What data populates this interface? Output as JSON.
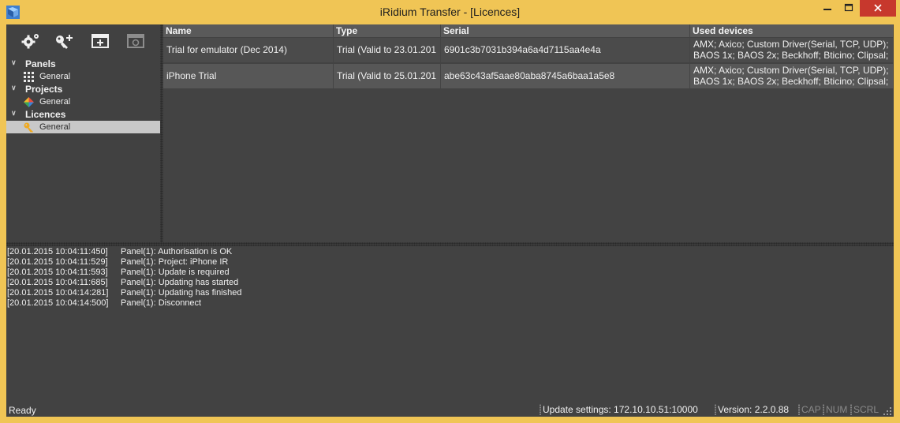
{
  "window": {
    "title": "iRidium Transfer - [Licences]",
    "accent": "#f0c555",
    "close_color": "#c7382d"
  },
  "toolbar": {
    "icons": [
      "settings-gears-icon",
      "add-key-icon",
      "add-window-icon",
      "remove-window-icon"
    ]
  },
  "tree": {
    "groups": [
      {
        "label": "Panels",
        "item": "General",
        "icon": "grid-dots-icon"
      },
      {
        "label": "Projects",
        "item": "General",
        "icon": "colored-diamond-icon"
      },
      {
        "label": "Licences",
        "item": "General",
        "icon": "key-icon",
        "selected": true
      }
    ]
  },
  "table": {
    "columns": [
      "Name",
      "Type",
      "Serial",
      "Used devices"
    ],
    "rows": [
      {
        "name": "Trial for emulator (Dec 2014)",
        "type": "Trial (Valid to 23.01.201",
        "serial": "6901c3b7031b394a6a4d7115aa4e4a",
        "devices_line1": "AMX; Axico; Custom Driver(Serial, TCP, UDP);",
        "devices_line2": "BAOS 1x; BAOS 2x; Beckhoff; Bticino; Clipsal;"
      },
      {
        "name": "iPhone Trial",
        "type": "Trial (Valid to 25.01.201",
        "serial": "abe63c43af5aae80aba8745a6baa1a5e8",
        "devices_line1": "AMX; Axico; Custom Driver(Serial, TCP, UDP);",
        "devices_line2": "BAOS 1x; BAOS 2x; Beckhoff; Bticino; Clipsal;"
      }
    ]
  },
  "log": [
    {
      "ts": "[20.01.2015 10:04:11:450]",
      "msg": "Panel(1): Authorisation is OK"
    },
    {
      "ts": "[20.01.2015 10:04:11:529]",
      "msg": "Panel(1): Project: iPhone IR"
    },
    {
      "ts": "[20.01.2015 10:04:11:593]",
      "msg": "Panel(1): Update is required"
    },
    {
      "ts": "[20.01.2015 10:04:11:685]",
      "msg": "Panel(1): Updating has started"
    },
    {
      "ts": "[20.01.2015 10:04:14:281]",
      "msg": "Panel(1): Updating has finished"
    },
    {
      "ts": "[20.01.2015 10:04:14:500]",
      "msg": "Panel(1): Disconnect"
    }
  ],
  "status": {
    "ready": "Ready",
    "update_settings": "Update settings: 172.10.10.51:10000",
    "version": "Version: 2.2.0.88",
    "cap": "CAP",
    "num": "NUM",
    "scrl": "SCRL"
  }
}
